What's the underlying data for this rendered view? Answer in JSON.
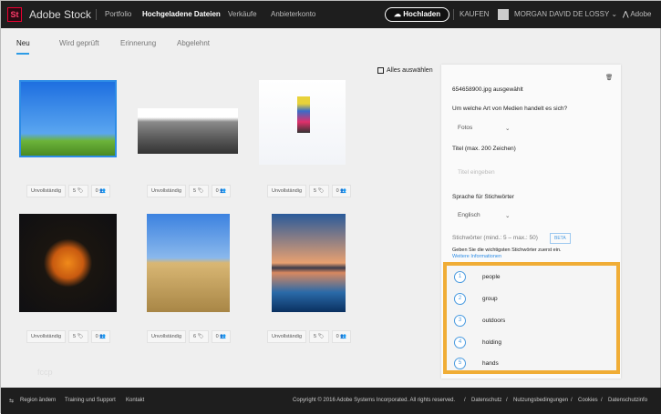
{
  "header": {
    "logo": "St",
    "brand": "Adobe Stock",
    "nav": [
      "Portfolio",
      "Hochgeladene Dateien",
      "Verkäufe",
      "Anbieterkonto"
    ],
    "upload": "Hochladen",
    "buy": "KAUFEN",
    "user": "MORGAN DAVID DE LOSSY",
    "adobe": "Adobe"
  },
  "tabs": [
    "Neu",
    "Wird geprüft",
    "Erinnerung",
    "Abgelehnt"
  ],
  "select_all": "Alles auswählen",
  "items": [
    {
      "status": "Unvollständig",
      "keywords": "5",
      "people": "0"
    },
    {
      "status": "Unvollständig",
      "keywords": "5",
      "people": "0"
    },
    {
      "status": "Unvollständig",
      "keywords": "5",
      "people": "0"
    },
    {
      "status": "Unvollständig",
      "keywords": "5",
      "people": "0"
    },
    {
      "status": "Unvollständig",
      "keywords": "6",
      "people": "0"
    },
    {
      "status": "Unvollständig",
      "keywords": "5",
      "people": "0"
    }
  ],
  "faint_text": "fccp",
  "panel": {
    "selected": "654658900.jpg ausgewählt",
    "media_q": "Um welche Art von Medien handelt es sich?",
    "media_val": "Fotos",
    "title_label": "Titel (max. 200 Zeichen)",
    "title_placeholder": "Titel eingeben",
    "lang_label": "Sprache für Stichwörter",
    "lang_val": "Englisch",
    "kw_label": "Stichwörter (mind.: 5 – max.: 50)",
    "beta": "BETA",
    "kw_hint": "Geben Sie die wichtigsten Stichwörter zuerst ein.",
    "more": "Weitere Informationen"
  },
  "keywords": [
    {
      "n": "1",
      "w": "people"
    },
    {
      "n": "2",
      "w": "group"
    },
    {
      "n": "3",
      "w": "outdoors"
    },
    {
      "n": "4",
      "w": "holding"
    },
    {
      "n": "5",
      "w": "hands"
    }
  ],
  "footer": {
    "region": "Region ändern",
    "training": "Training und Support",
    "contact": "Kontakt",
    "copyright": "Copyright © 2016 Adobe Systems Incorporated. All rights reserved.",
    "links": [
      "Datenschutz",
      "Nutzungsbedingungen",
      "Cookies",
      "Datenschutzinfo"
    ]
  }
}
